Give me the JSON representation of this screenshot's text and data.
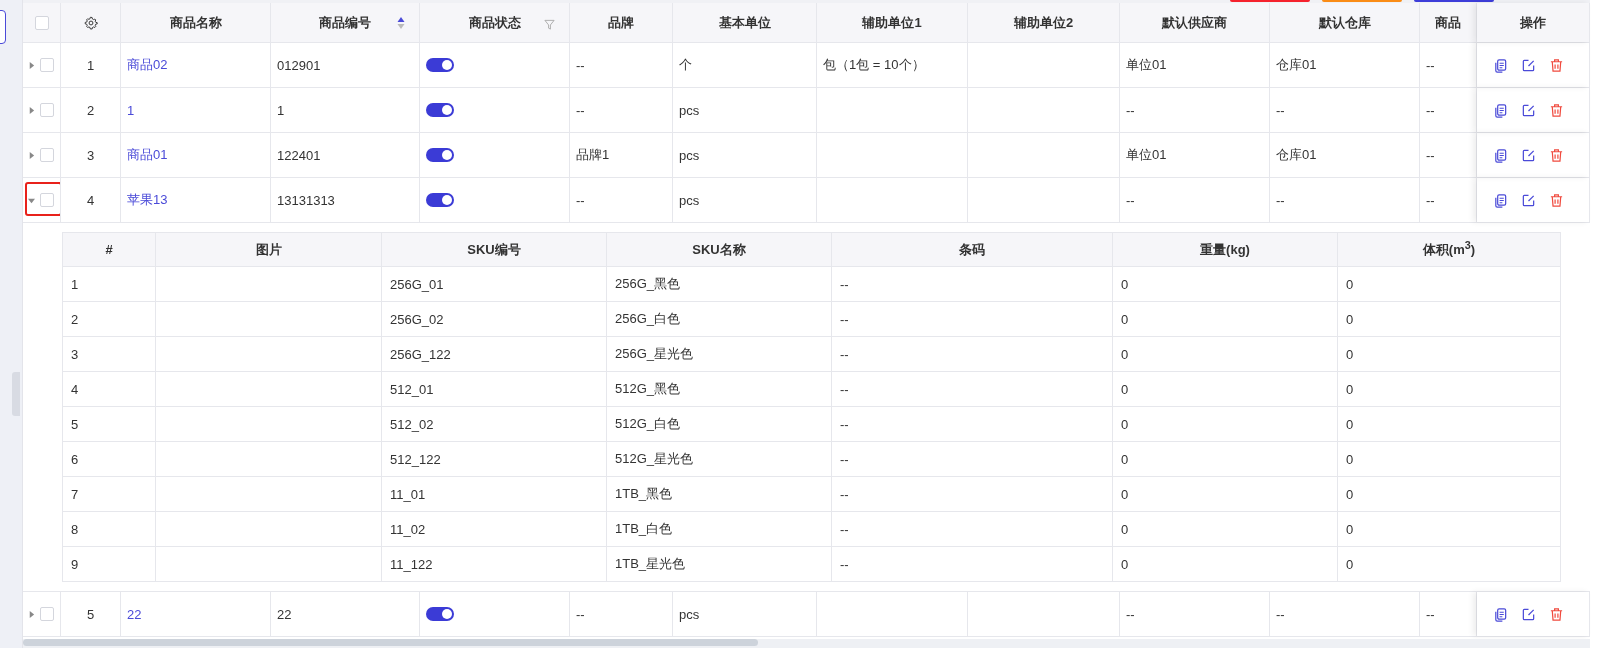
{
  "top_buttons": [
    {
      "color": "#f5222d"
    },
    {
      "color": "#fa8c16"
    },
    {
      "color": "#3d3dd9"
    }
  ],
  "table": {
    "all_checked": false,
    "columns": [
      {
        "label": "商品名称"
      },
      {
        "label": "商品编号",
        "sorted_ascending": true
      },
      {
        "label": "商品状态",
        "filter": true
      },
      {
        "label": "品牌"
      },
      {
        "label": "基本单位"
      },
      {
        "label": "辅助单位1"
      },
      {
        "label": "辅助单位2"
      },
      {
        "label": "默认供应商"
      },
      {
        "label": "默认仓库"
      },
      {
        "label": "商品"
      }
    ],
    "actions_header": "操作",
    "rows": [
      {
        "index": "1",
        "cells": [
          "商品02",
          "012901",
          null,
          "--",
          "个",
          "包（1包 = 10个）",
          "",
          "单位01",
          "仓库01",
          "--"
        ],
        "enabled": true,
        "checked": false,
        "expanded": false,
        "marked": false
      },
      {
        "index": "2",
        "cells": [
          "1",
          "1",
          null,
          "--",
          "pcs",
          "",
          "",
          "--",
          "--",
          "--"
        ],
        "enabled": true,
        "checked": false,
        "expanded": false,
        "marked": false
      },
      {
        "index": "3",
        "cells": [
          "商品01",
          "122401",
          null,
          "品牌1",
          "pcs",
          "",
          "",
          "单位01",
          "仓库01",
          "--"
        ],
        "enabled": true,
        "checked": false,
        "expanded": false,
        "marked": false
      },
      {
        "index": "4",
        "cells": [
          "苹果13",
          "13131313",
          null,
          "--",
          "pcs",
          "",
          "",
          "--",
          "--",
          "--"
        ],
        "enabled": true,
        "checked": false,
        "expanded": true,
        "marked": true,
        "skus": {
          "columns": [
            "#",
            "图片",
            "SKU编号",
            "SKU名称",
            "条码",
            "重量(kg)",
            "体积(m$^{3}$)"
          ],
          "rows": [
            [
              "1",
              "",
              "256G_01",
              "256G_黑色",
              "--",
              "0",
              "0"
            ],
            [
              "2",
              "",
              "256G_02",
              "256G_白色",
              "--",
              "0",
              "0"
            ],
            [
              "3",
              "",
              "256G_122",
              "256G_星光色",
              "--",
              "0",
              "0"
            ],
            [
              "4",
              "",
              "512_01",
              "512G_黑色",
              "--",
              "0",
              "0"
            ],
            [
              "5",
              "",
              "512_02",
              "512G_白色",
              "--",
              "0",
              "0"
            ],
            [
              "6",
              "",
              "512_122",
              "512G_星光色",
              "--",
              "0",
              "0"
            ],
            [
              "7",
              "",
              "11_01",
              "1TB_黑色",
              "--",
              "0",
              "0"
            ],
            [
              "8",
              "",
              "11_02",
              "1TB_白色",
              "--",
              "0",
              "0"
            ],
            [
              "9",
              "",
              "11_122",
              "1TB_星光色",
              "--",
              "0",
              "0"
            ]
          ]
        }
      },
      {
        "index": "5",
        "cells": [
          "22",
          "22",
          null,
          "--",
          "pcs",
          "",
          "",
          "--",
          "--",
          "--"
        ],
        "enabled": true,
        "checked": false,
        "expanded": false,
        "marked": false
      }
    ]
  }
}
